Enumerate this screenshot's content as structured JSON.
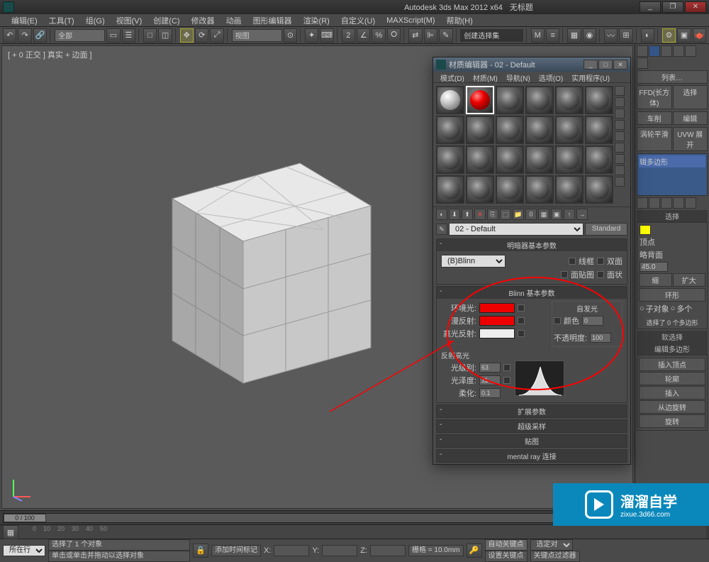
{
  "titlebar": {
    "app": "Autodesk 3ds Max 2012 x64",
    "doc": "无标题"
  },
  "menu": [
    "编辑(E)",
    "工具(T)",
    "组(G)",
    "视图(V)",
    "创建(C)",
    "修改器",
    "动画",
    "图形编辑器",
    "渲染(R)",
    "自定义(U)",
    "MAXScript(M)",
    "帮助(H)"
  ],
  "toolbar": {
    "combo1": "全部",
    "view_combo": "视图",
    "action_combo": "创建选择集"
  },
  "viewport": {
    "label": "[ + 0 正交 ] 真实 + 边面 ]"
  },
  "cmd_panel": {
    "section1": "列表…",
    "btn_ffd": "FFD(长方体)",
    "btn_select": "选择",
    "btn_car": "车削",
    "btn_edit": "编辑",
    "btn_turbo": "涡轮平滑",
    "btn_uvw": "UVW 展开",
    "modifier_label": "辑多边形",
    "panel_select": "选择",
    "vertex": "顶点",
    "backface": "略背面",
    "angle": "45.0",
    "btn_shrink": "缩",
    "btn_grow": "扩大",
    "btn_ring": "环形",
    "by_obj": "子对象",
    "by_more": "多个",
    "sel_status": "选择了 0 个多边形",
    "soft_sel": "软选择",
    "edit_poly": "编辑多边形",
    "insert_v": "插入顶点",
    "outline": "轮廓",
    "insert": "插入",
    "from_edge": "从边旋转",
    "rotate": "旋转"
  },
  "mat_editor": {
    "title": "材质编辑器 - 02 - Default",
    "menu": [
      "模式(D)",
      "材质(M)",
      "导航(N)",
      "选项(O)",
      "实用程序(U)"
    ],
    "name": "02 - Default",
    "std_btn": "Standard",
    "shader_header": "明暗器基本参数",
    "shader": "(B)Blinn",
    "wire": "线框",
    "two_side": "双面",
    "face_map": "面贴图",
    "faceted": "面状",
    "blinn_header": "Blinn 基本参数",
    "self_illum": "自发光",
    "color_cb": "颜色",
    "color_val": "0",
    "ambient": "环境光:",
    "diffuse": "漫反射:",
    "specular": "高光反射:",
    "opacity": "不透明度:",
    "opacity_val": "100",
    "spec_hl": "反射高光",
    "spec_level": "光级别:",
    "spec_level_val": "63",
    "gloss": "光泽度:",
    "gloss_val": "11",
    "soften": "柔化:",
    "soften_val": "0.1",
    "rollouts": [
      "扩展参数",
      "超级采样",
      "贴图",
      "mental ray 连接"
    ]
  },
  "timeline": {
    "pos": "0 / 100"
  },
  "status": {
    "loc_btn": "所在行:",
    "prompt1": "选择了 1 个对象",
    "prompt2": "单击或单击并拖动以选择对象",
    "add_time": "添加时间标记",
    "x": "X:",
    "y": "Y:",
    "z": "Z:",
    "grid": "栅格 = 10.0mm",
    "autokey": "自动关键点",
    "selset": "选定对象",
    "setkey": "设置关键点",
    "keyfilter": "关键点过滤器"
  },
  "watermark": {
    "title": "溜溜自学",
    "url": "zixue.3d66.com"
  }
}
